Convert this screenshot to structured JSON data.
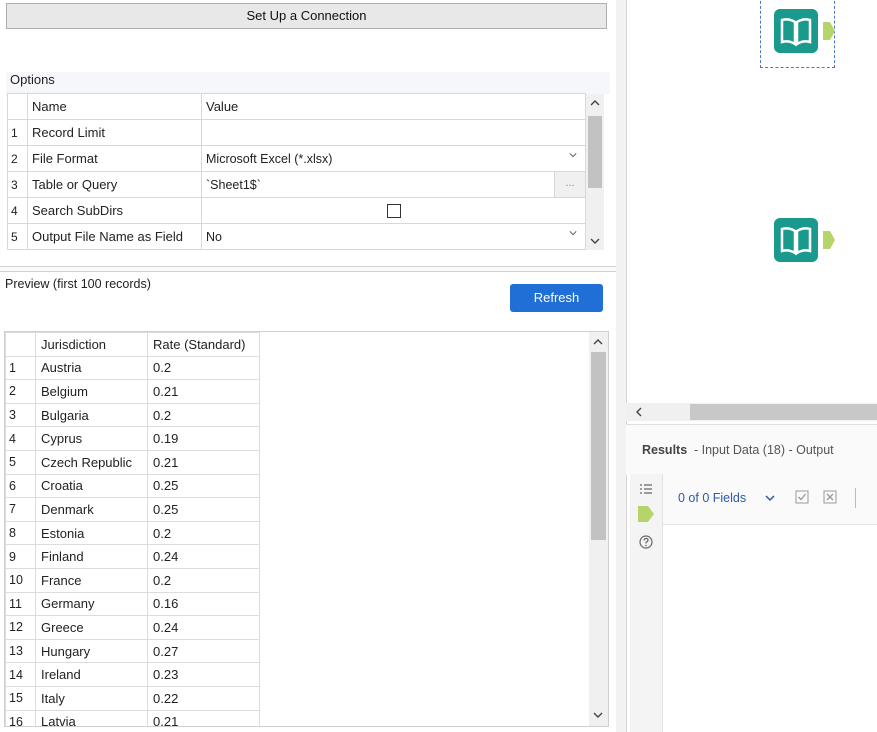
{
  "connection_button": "Set Up a Connection",
  "options": {
    "title": "Options",
    "headers": [
      "Name",
      "Value"
    ],
    "rows": [
      {
        "num": "1",
        "name": "Record Limit",
        "value": ""
      },
      {
        "num": "2",
        "name": "File Format",
        "value": "Microsoft Excel (*.xlsx)"
      },
      {
        "num": "3",
        "name": "Table or Query",
        "value": "`Sheet1$`",
        "button": "..."
      },
      {
        "num": "4",
        "name": "Search SubDirs",
        "value": ""
      },
      {
        "num": "5",
        "name": "Output File Name as Field",
        "value": "No"
      }
    ]
  },
  "preview": {
    "title": "Preview (first 100 records)",
    "refresh_label": "Refresh",
    "headers": [
      "Jurisdiction",
      "Rate (Standard)"
    ],
    "rows": [
      [
        "1",
        "Austria",
        "0.2"
      ],
      [
        "2",
        "Belgium",
        "0.21"
      ],
      [
        "3",
        "Bulgaria",
        "0.2"
      ],
      [
        "4",
        "Cyprus",
        "0.19"
      ],
      [
        "5",
        "Czech Republic",
        "0.21"
      ],
      [
        "6",
        "Croatia",
        "0.25"
      ],
      [
        "7",
        "Denmark",
        "0.25"
      ],
      [
        "8",
        "Estonia",
        "0.2"
      ],
      [
        "9",
        "Finland",
        "0.24"
      ],
      [
        "10",
        "France",
        "0.2"
      ],
      [
        "11",
        "Germany",
        "0.16"
      ],
      [
        "12",
        "Greece",
        "0.24"
      ],
      [
        "13",
        "Hungary",
        "0.27"
      ],
      [
        "14",
        "Ireland",
        "0.23"
      ],
      [
        "15",
        "Italy",
        "0.22"
      ],
      [
        "16",
        "Latvia",
        "0.21"
      ]
    ]
  },
  "results": {
    "title": "Results",
    "subtitle": "- Input Data (18) - Output",
    "fields_label": "0 of 0 Fields"
  },
  "colors": {
    "accent": "#1f6fd6",
    "tool_teal": "#1a9a8c",
    "anchor_green": "#b5d56a"
  },
  "icons": [
    "book-tool-icon",
    "output-anchor-icon",
    "list-icon",
    "help-icon",
    "check-icon",
    "clear-icon"
  ]
}
